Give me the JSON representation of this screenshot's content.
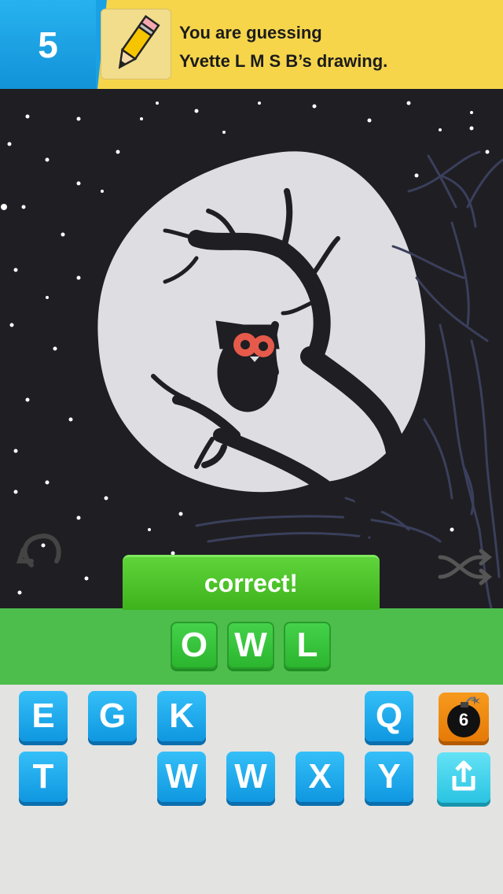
{
  "header": {
    "score": "5",
    "line1": "You are guessing",
    "line2": "Yvette L M S B’s drawing."
  },
  "canvas": {
    "drawing_subject": "owl on branch in front of full moon"
  },
  "correct_banner": "correct!",
  "answer_tiles": [
    "O",
    "W",
    "L"
  ],
  "keyboard": {
    "row1": [
      "E",
      "G",
      "K",
      "Q"
    ],
    "row2": [
      "T",
      "W",
      "W",
      "X",
      "Y"
    ]
  },
  "bomb_count": "6",
  "colors": {
    "header_bg": "#f6d54b",
    "score_bg": "#1a9fe3",
    "canvas_bg": "#1f1e22",
    "green": "#4dbd4c",
    "key_blue": "#1fa8ec",
    "bomb_orange": "#f0880f",
    "share_cyan": "#3fd0ea"
  }
}
